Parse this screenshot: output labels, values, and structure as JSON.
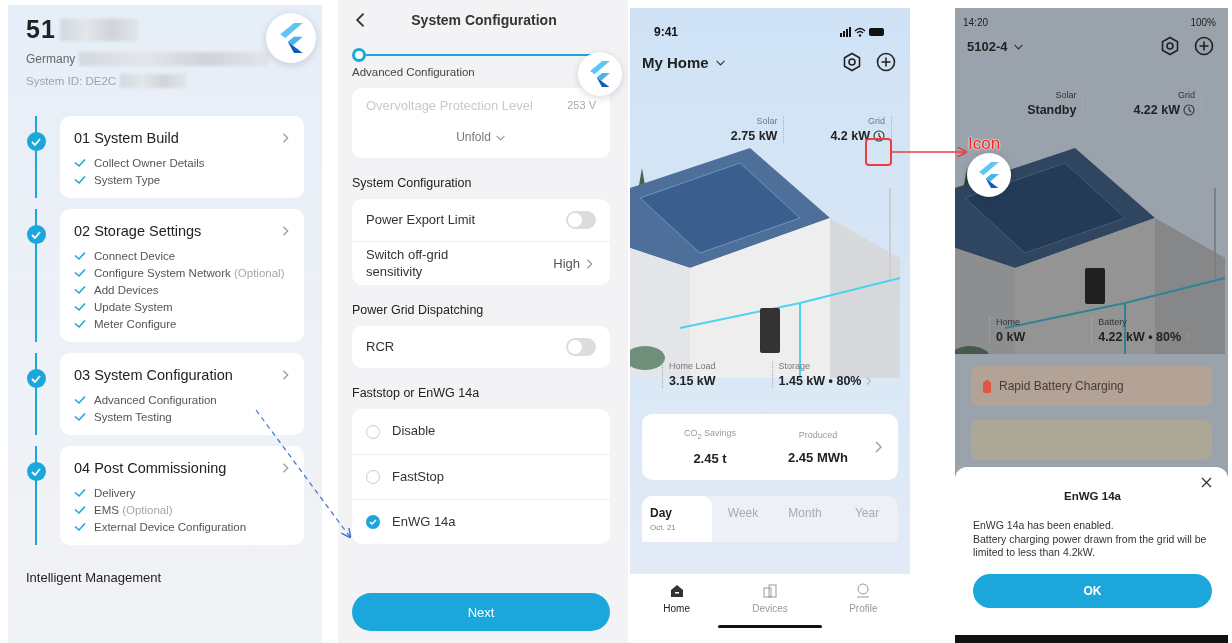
{
  "commissioning": {
    "system_name": "51",
    "location": "Germany",
    "system_id": "System ID: DE2C",
    "steps": [
      {
        "title": "01 System Build",
        "done": true,
        "items": [
          {
            "label": "Collect Owner Details",
            "checked": true
          },
          {
            "label": "System Type",
            "checked": true
          }
        ]
      },
      {
        "title": "02 Storage Settings",
        "done": true,
        "items": [
          {
            "label": "Connect Device",
            "checked": true
          },
          {
            "label": "Configure System Network",
            "note": "(Optional)",
            "checked": true
          },
          {
            "label": "Add Devices",
            "checked": true
          },
          {
            "label": "Update System",
            "checked": true
          },
          {
            "label": "Meter Configure",
            "checked": true
          }
        ]
      },
      {
        "title": "03 System Configuration",
        "done": true,
        "items": [
          {
            "label": "Advanced Configuration",
            "checked": true
          },
          {
            "label": "System Testing",
            "checked": true
          }
        ]
      },
      {
        "title": "04 Post Commissioning",
        "done": true,
        "items": [
          {
            "label": "Delivery",
            "checked": true
          },
          {
            "label": "EMS",
            "note": "(Optional)",
            "checked": true
          },
          {
            "label": "External Device Configuration",
            "checked": true
          }
        ]
      }
    ],
    "footer_section": "Intelligent Management"
  },
  "system_configuration": {
    "title": "System Configuration",
    "stepper_label": "Advanced Configuration",
    "faded_row": {
      "label": "Overvoltage Protection Level",
      "value": "253 V"
    },
    "unfold": "Unfold",
    "sections": [
      {
        "heading": "System Configuration",
        "rows": [
          {
            "kind": "toggle",
            "label": "Power Export Limit",
            "on": false
          },
          {
            "kind": "value",
            "label": "Switch off-grid sensitivity",
            "value": "High"
          }
        ]
      },
      {
        "heading": "Power Grid Dispatching",
        "rows": [
          {
            "kind": "toggle",
            "label": "RCR",
            "on": false
          }
        ]
      },
      {
        "heading": "Faststop or EnWG 14a",
        "rows": [
          {
            "kind": "radio",
            "label": "Disable",
            "selected": false
          },
          {
            "kind": "radio",
            "label": "FastStop",
            "selected": false
          },
          {
            "kind": "radio",
            "label": "EnWG 14a",
            "selected": true
          }
        ]
      }
    ],
    "next_button": "Next"
  },
  "home_screen": {
    "time": "9:41",
    "home_name": "My Home",
    "stats_top": [
      {
        "label": "Solar",
        "value": "2.75 kW"
      },
      {
        "label": "Grid",
        "value": "4.2 kW"
      }
    ],
    "stats_bottom": [
      {
        "label": "Home Load",
        "value": "3.15 kW"
      },
      {
        "label": "Storage",
        "value": "1.45 kW • 80%"
      }
    ],
    "summary": [
      {
        "label": "CO$_{2}$ Savings",
        "value": "2.45 t"
      },
      {
        "label": "Produced",
        "value": "2.45 MWh"
      }
    ],
    "period_tabs": [
      {
        "label": "Day",
        "sub": "Oct. 21",
        "selected": true
      },
      {
        "label": "Week",
        "selected": false
      },
      {
        "label": "Month",
        "selected": false
      },
      {
        "label": "Year",
        "selected": false
      }
    ],
    "nav": [
      {
        "label": "Home",
        "selected": true
      },
      {
        "label": "Devices",
        "selected": false
      },
      {
        "label": "Profile",
        "selected": false
      }
    ]
  },
  "enwg_screen": {
    "time": "14:20",
    "battery": "100%",
    "home_name": "5102-4",
    "stats_top": [
      {
        "label": "Solar",
        "value": "Standby"
      },
      {
        "label": "Grid",
        "value": "4.22 kW"
      }
    ],
    "stats_bottom": [
      {
        "label": "Home",
        "value": "0 kW"
      },
      {
        "label": "Battery",
        "value": "4.22 kW • 80%"
      }
    ],
    "banner": "Rapid Battery Charging",
    "dialog": {
      "title": "EnWG 14a",
      "message": "EnWG 14a has been enabled.\nBattery charging power drawn from the grid will be limited to less than 4.2kW.",
      "button": "OK"
    }
  },
  "annotations": {
    "icon_label": "Icon"
  }
}
